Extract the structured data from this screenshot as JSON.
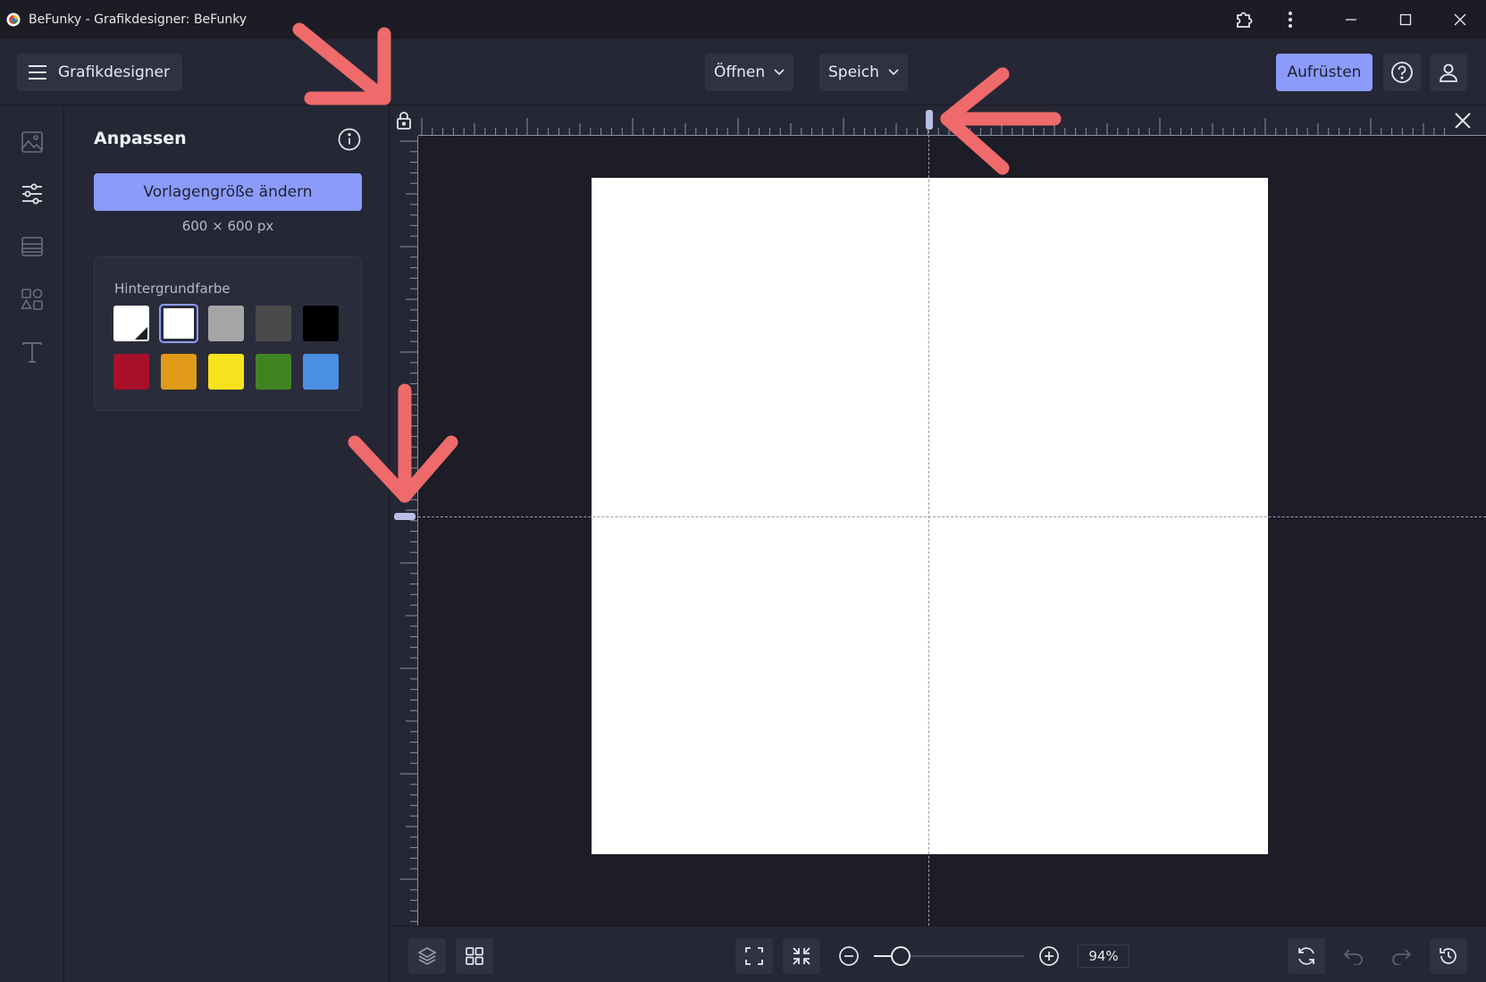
{
  "window": {
    "title": "BeFunky - Grafikdesigner: BeFunky"
  },
  "topbar": {
    "menu_label": "Grafikdesigner",
    "open_label": "Öffnen",
    "save_label": "Speich",
    "upgrade_label": "Aufrüsten"
  },
  "rail": {
    "items": [
      "image-icon",
      "sliders-icon",
      "layout-icon",
      "shapes-icon",
      "text-icon"
    ],
    "active": "sliders-icon"
  },
  "panel": {
    "title": "Anpassen",
    "resize_label": "Vorlagengröße ändern",
    "size_text": "600 × 600 px",
    "background_label": "Hintergrundfarbe",
    "swatches": [
      {
        "name": "transparent",
        "color": "#ffffff"
      },
      {
        "name": "white",
        "color": "#ffffff",
        "selected": true
      },
      {
        "name": "gray",
        "color": "#a5a5a5"
      },
      {
        "name": "dark-gray",
        "color": "#4a4a4a"
      },
      {
        "name": "black",
        "color": "#000000"
      },
      {
        "name": "red",
        "color": "#a8102a"
      },
      {
        "name": "orange",
        "color": "#e09a18"
      },
      {
        "name": "yellow",
        "color": "#f7e21e"
      },
      {
        "name": "green",
        "color": "#3f8421"
      },
      {
        "name": "blue",
        "color": "#4a90e2"
      }
    ]
  },
  "zoom": {
    "value_text": "94%",
    "level": 0.18
  },
  "colors": {
    "accent": "#8c9bfb",
    "annotation_arrow": "#ef6a6a",
    "canvas": "#ffffff"
  }
}
